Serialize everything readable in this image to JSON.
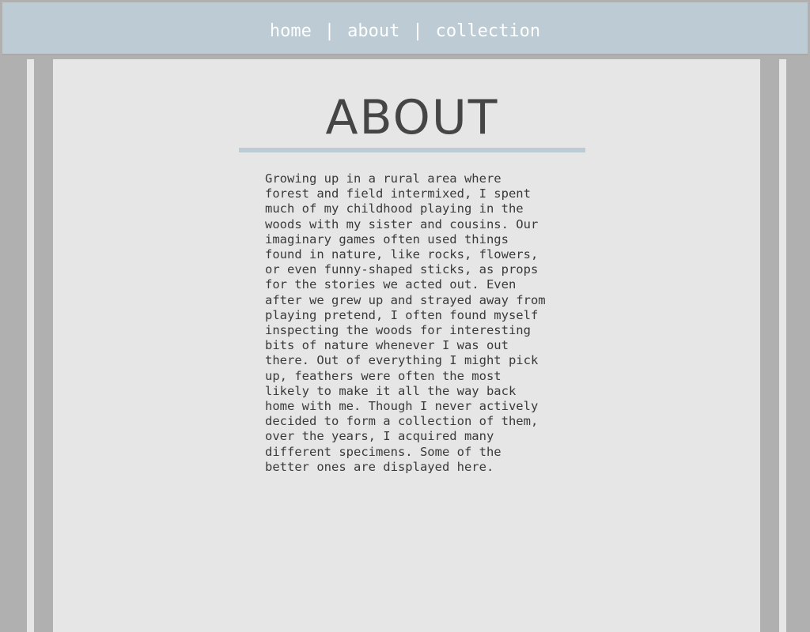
{
  "nav": {
    "items": [
      {
        "label": "home"
      },
      {
        "label": "about"
      },
      {
        "label": "collection"
      }
    ],
    "separator": "|"
  },
  "page": {
    "title": "ABOUT",
    "body": "Growing up in a rural area where\nforest and field intermixed, I spent\nmuch of my childhood playing in the\nwoods with my sister and cousins. Our\nimaginary games often used things\nfound in nature, like rocks, flowers,\nor even funny-shaped sticks, as props\nfor the stories we acted out. Even\nafter we grew up and strayed away from\nplaying pretend, I often found myself\ninspecting the woods for interesting\nbits of nature whenever I was out\nthere. Out of everything I might pick\nup, feathers were often the most\nlikely to make it all the way back\nhome with me. Though I never actively\ndecided to form a collection of them,\nover the years, I acquired many\ndifferent specimens. Some of the\nbetter ones are displayed here."
  },
  "colors": {
    "nav_background": "#bccbd4",
    "page_background": "#b0b0b0",
    "panel_background": "#e6e6e6",
    "title_color": "#454545",
    "accent_rule": "#bccbd4"
  }
}
